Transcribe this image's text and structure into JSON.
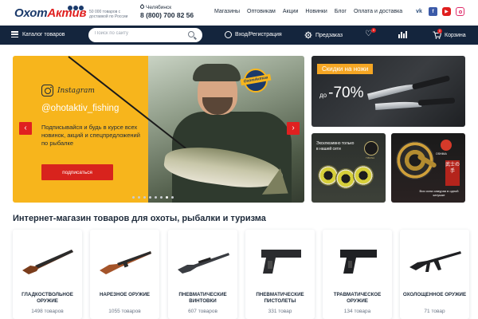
{
  "header": {
    "logo_part1": "Охот",
    "logo_part2": "Актив",
    "tagline": "50 000 товаров с доставкой по России",
    "city": "Челябинск",
    "phone": "8 (800) 700 82 56",
    "nav": [
      "Магазины",
      "Оптовикам",
      "Акции",
      "Новинки",
      "Блог",
      "Оплата и доставка"
    ],
    "social": [
      "vk-icon",
      "facebook-icon",
      "youtube-icon",
      "instagram-icon"
    ],
    "vk_text": "vk"
  },
  "navbar": {
    "catalog_label": "Каталог товаров",
    "search_placeholder": "Поиск по сайту",
    "login_label": "Вход/Регистрация",
    "preorder_label": "Предзаказ",
    "favorites_badge": "0",
    "cart_label": "Корзина",
    "cart_badge": "0"
  },
  "hero": {
    "instagram_word": "Instagram",
    "handle": "@ohotaktiv_fishing",
    "text": "Подписывайся и будь в курсе всех новинок, акций и спецпредложений по рыбалке",
    "button": "подписаться",
    "sticker": "ОхотАктив",
    "prev_arrow": "‹",
    "next_arrow": "›",
    "slide_count": 8,
    "active_slide": 6
  },
  "promos": {
    "knives_tag": "Скидки на ножи",
    "knives_prefix": "до",
    "knives_value": "-70%",
    "line_text": "Эксклюзивно только в нашей сети",
    "line_brand": "TIBONA",
    "reel_brand": "OSHIMA",
    "reel_kanji": "武士の手",
    "reel_text": "Вся сила самурая в одной катушке"
  },
  "section_title": "Интернет-магазин товаров для охоты, рыбалки и туризма",
  "categories": [
    {
      "name": "Гладкоствольное оружие",
      "count": "1498 товаров",
      "icon": "shotgun-icon"
    },
    {
      "name": "Нарезное оружие",
      "count": "1055 товаров",
      "icon": "rifle-icon"
    },
    {
      "name": "Пневматические винтовки",
      "count": "607 товаров",
      "icon": "air-rifle-icon"
    },
    {
      "name": "Пневматические пистолеты",
      "count": "331 товар",
      "icon": "air-pistol-icon"
    },
    {
      "name": "Травматическое оружие",
      "count": "134 товара",
      "icon": "traumatic-pistol-icon"
    },
    {
      "name": "Охолощенное оружие",
      "count": "71 товар",
      "icon": "blank-firing-rifle-icon"
    }
  ],
  "colors": {
    "navy": "#14253d",
    "accent_red": "#e02020",
    "banner_yellow": "#f7b51c",
    "promo_orange": "#f5a623"
  }
}
